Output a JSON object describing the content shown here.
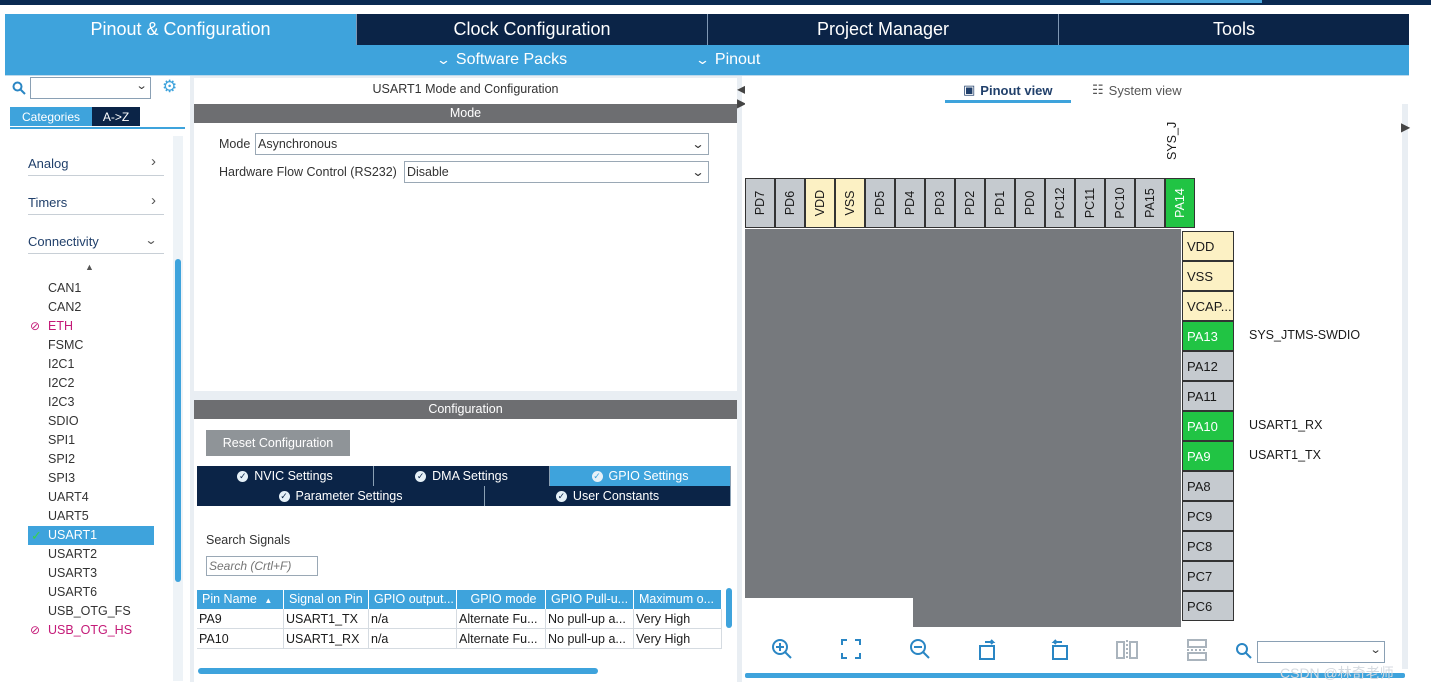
{
  "top_tabs": [
    {
      "label": "Pinout & Configuration"
    },
    {
      "label": "Clock Configuration"
    },
    {
      "label": "Project Manager"
    },
    {
      "label": "Tools"
    }
  ],
  "sub_menu": [
    {
      "label": "Software Packs"
    },
    {
      "label": "Pinout"
    }
  ],
  "left": {
    "tabs": [
      "Categories",
      "A->Z"
    ],
    "sections": [
      "Analog",
      "Timers",
      "Connectivity"
    ],
    "peripherals": [
      {
        "label": "CAN1",
        "state": "normal"
      },
      {
        "label": "CAN2",
        "state": "normal"
      },
      {
        "label": "ETH",
        "state": "error"
      },
      {
        "label": "FSMC",
        "state": "normal"
      },
      {
        "label": "I2C1",
        "state": "normal"
      },
      {
        "label": "I2C2",
        "state": "normal"
      },
      {
        "label": "I2C3",
        "state": "normal"
      },
      {
        "label": "SDIO",
        "state": "normal"
      },
      {
        "label": "SPI1",
        "state": "normal"
      },
      {
        "label": "SPI2",
        "state": "normal"
      },
      {
        "label": "SPI3",
        "state": "normal"
      },
      {
        "label": "UART4",
        "state": "normal"
      },
      {
        "label": "UART5",
        "state": "normal"
      },
      {
        "label": "USART1",
        "state": "selected"
      },
      {
        "label": "USART2",
        "state": "normal"
      },
      {
        "label": "USART3",
        "state": "normal"
      },
      {
        "label": "USART6",
        "state": "normal"
      },
      {
        "label": "USB_OTG_FS",
        "state": "normal"
      },
      {
        "label": "USB_OTG_HS",
        "state": "error"
      }
    ]
  },
  "mode_panel": {
    "title": "USART1 Mode and Configuration",
    "mode_header": "Mode",
    "mode_label": "Mode",
    "mode_value": "Asynchronous",
    "flow_label": "Hardware Flow Control (RS232)",
    "flow_value": "Disable"
  },
  "config_panel": {
    "header": "Configuration",
    "reset_label": "Reset Configuration",
    "tabs_row1": [
      "NVIC Settings",
      "DMA Settings",
      "GPIO Settings"
    ],
    "tabs_row2": [
      "Parameter Settings",
      "User Constants"
    ],
    "search_label": "Search Signals",
    "search_placeholder": "Search (Crtl+F)",
    "columns": [
      "Pin Name",
      "Signal on Pin",
      "GPIO output...",
      "GPIO mode",
      "GPIO Pull-u...",
      "Maximum o..."
    ],
    "rows": [
      [
        "PA9",
        "USART1_TX",
        "n/a",
        "Alternate Fu...",
        "No pull-up a...",
        "Very High"
      ],
      [
        "PA10",
        "USART1_RX",
        "n/a",
        "Alternate Fu...",
        "No pull-up a...",
        "Very High"
      ]
    ]
  },
  "pinout": {
    "view_tabs": [
      "Pinout view",
      "System view"
    ],
    "sys_label": "SYS_J",
    "top_pins": [
      {
        "name": "PD7",
        "kind": "io"
      },
      {
        "name": "PD6",
        "kind": "io"
      },
      {
        "name": "VDD",
        "kind": "power"
      },
      {
        "name": "VSS",
        "kind": "power"
      },
      {
        "name": "PD5",
        "kind": "io"
      },
      {
        "name": "PD4",
        "kind": "io"
      },
      {
        "name": "PD3",
        "kind": "io"
      },
      {
        "name": "PD2",
        "kind": "io"
      },
      {
        "name": "PD1",
        "kind": "io"
      },
      {
        "name": "PD0",
        "kind": "io"
      },
      {
        "name": "PC12",
        "kind": "io"
      },
      {
        "name": "PC11",
        "kind": "io"
      },
      {
        "name": "PC10",
        "kind": "io"
      },
      {
        "name": "PA15",
        "kind": "io"
      },
      {
        "name": "PA14",
        "kind": "assigned"
      }
    ],
    "right_pins": [
      {
        "name": "VDD",
        "kind": "power",
        "signal": ""
      },
      {
        "name": "VSS",
        "kind": "power",
        "signal": ""
      },
      {
        "name": "VCAP...",
        "kind": "power",
        "signal": ""
      },
      {
        "name": "PA13",
        "kind": "assigned",
        "signal": "SYS_JTMS-SWDIO"
      },
      {
        "name": "PA12",
        "kind": "io",
        "signal": ""
      },
      {
        "name": "PA11",
        "kind": "io",
        "signal": ""
      },
      {
        "name": "PA10",
        "kind": "assigned",
        "signal": "USART1_RX"
      },
      {
        "name": "PA9",
        "kind": "assigned",
        "signal": "USART1_TX"
      },
      {
        "name": "PA8",
        "kind": "io",
        "signal": ""
      },
      {
        "name": "PC9",
        "kind": "io",
        "signal": ""
      },
      {
        "name": "PC8",
        "kind": "io",
        "signal": ""
      },
      {
        "name": "PC7",
        "kind": "io",
        "signal": ""
      },
      {
        "name": "PC6",
        "kind": "io",
        "signal": ""
      }
    ],
    "toolbar_icons": [
      "zoom-in-icon",
      "fit-screen-icon",
      "zoom-out-icon",
      "rotate-right-icon",
      "rotate-left-icon",
      "flip-vertical-icon",
      "flip-horizontal-icon",
      "search-icon"
    ]
  },
  "watermark": "CSDN @林奇老师",
  "colors": {
    "accent": "#3ea3dc",
    "navy": "#0b2447",
    "pin_green": "#21c444",
    "pin_yellow": "#fcf1c4",
    "pin_grey": "#c5cacf",
    "error": "#c41a78"
  }
}
